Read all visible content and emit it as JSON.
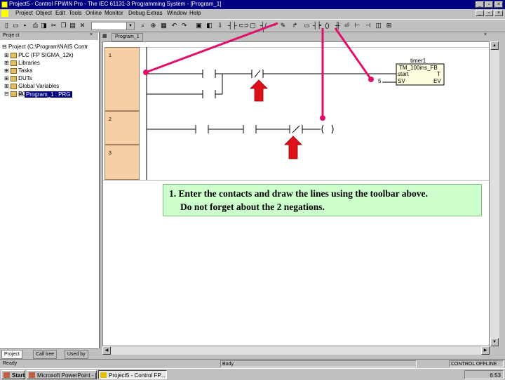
{
  "window": {
    "title": "Project5 - Control FPWIN Pro - The IEC 61131-3 Programming System - [Program_1]"
  },
  "menu": [
    "Project",
    "Object",
    "Edit",
    "Tools",
    "Online",
    "Monitor",
    "Debug",
    "Extras",
    "Window",
    "Help"
  ],
  "project_pane": {
    "header": "Proje ct",
    "tree": [
      {
        "label": "Project (C:\\Program\\NAIS Contr",
        "indent": 0
      },
      {
        "label": "PLC (FP SIGMA_12k)",
        "indent": 1
      },
      {
        "label": "Libraries",
        "indent": 1
      },
      {
        "label": "Tasks",
        "indent": 1
      },
      {
        "label": "DUTs",
        "indent": 1
      },
      {
        "label": "Global Variables",
        "indent": 1
      },
      {
        "label": "POUs",
        "indent": 1
      },
      {
        "label": "Program_1 : PRG",
        "indent": 2,
        "selected": true
      }
    ],
    "tabs": [
      "Project",
      "Call tree",
      "Used by"
    ]
  },
  "editor": {
    "tab": "Program_1",
    "network_numbers": [
      "1",
      "2",
      "3"
    ],
    "function_block": {
      "instance": "timer1",
      "type": "TM_100ms_FB",
      "inputs": [
        "start",
        "SV"
      ],
      "outputs": [
        "T",
        "EV"
      ],
      "sv_value": "5"
    }
  },
  "instruction": {
    "line1": "1. Enter the contacts and draw the lines using the toolbar above.",
    "line2": "Do not forget about the 2 negations."
  },
  "status_bar": {
    "left": "Ready",
    "mid": "Body",
    "right": "CONTROL OFFLINE"
  },
  "taskbar": {
    "start": "Start",
    "tasks": [
      "Microsoft PowerPoint - [Ha...",
      "Project5 - Control FP..."
    ],
    "clock": "6:53"
  },
  "colors": {
    "arrow": "#e0106a",
    "marker": "#e0101a",
    "instruction_bg": "#ccffcc",
    "network_col": "#f6cfa7"
  }
}
